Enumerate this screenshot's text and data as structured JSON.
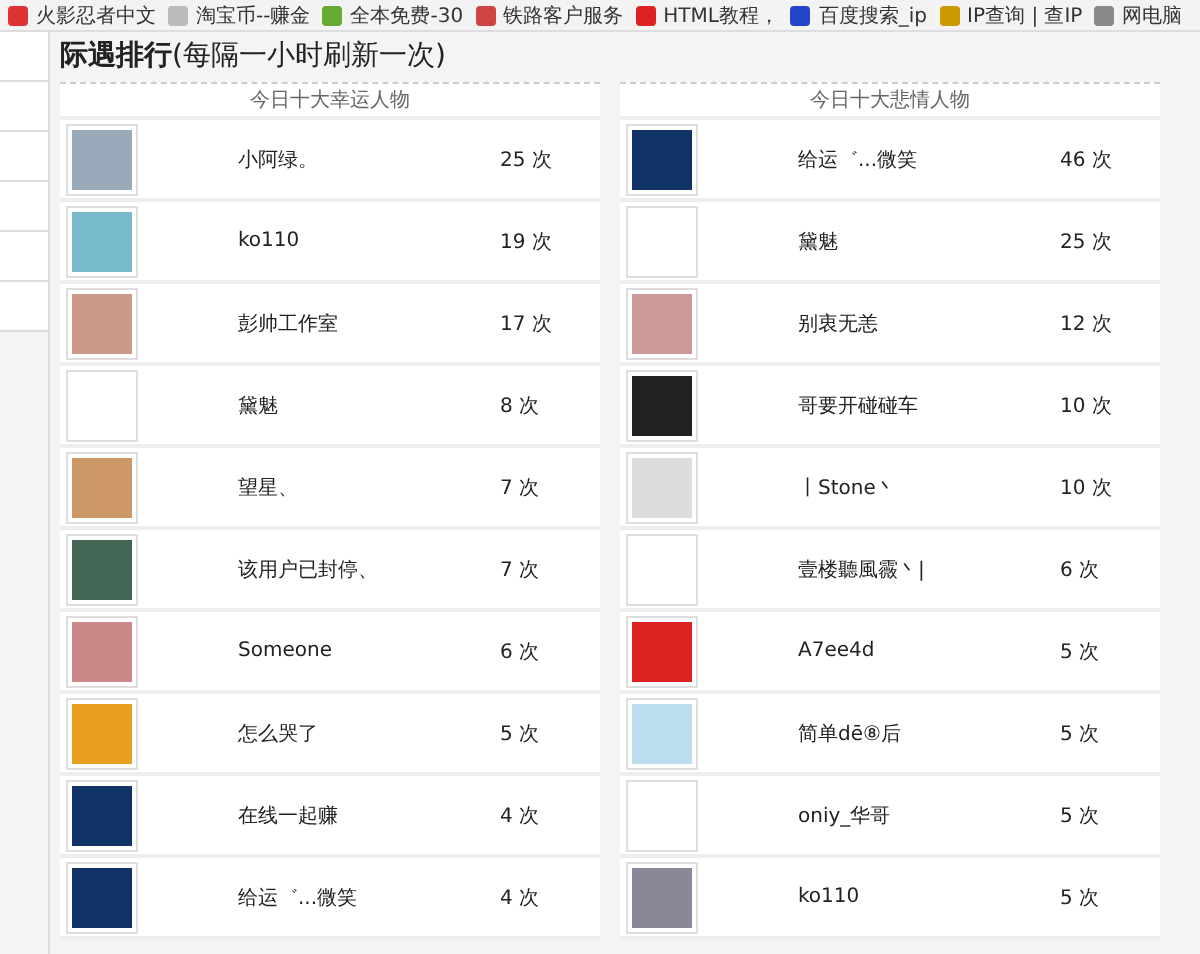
{
  "bookmarks": [
    {
      "label": "火影忍者中文"
    },
    {
      "label": "淘宝币--赚金"
    },
    {
      "label": "全本免费-30"
    },
    {
      "label": "铁路客户服务"
    },
    {
      "label": "HTML教程，"
    },
    {
      "label": "百度搜索_ip"
    },
    {
      "label": "IP查询 | 查IP"
    },
    {
      "label": "网电脑"
    }
  ],
  "panel": {
    "title": "**际遇排行**(每隔一小时刷新一次)",
    "lists": [
      {
        "heading": "今日十大幸运人物",
        "rows": [
          {
            "kind": "photo",
            "name": "小阿绿。",
            "count": "25 次"
          },
          {
            "kind": "photo",
            "name": "ko110",
            "count": "19 次"
          },
          {
            "kind": "photo",
            "name": "彭帅工作室",
            "count": "17 次"
          },
          {
            "kind": "empty",
            "name": "黛魅",
            "count": "8 次"
          },
          {
            "kind": "photo",
            "name": "望星、",
            "count": "7 次"
          },
          {
            "kind": "photo",
            "name": "该用户已封停、",
            "count": "7 次"
          },
          {
            "kind": "photo",
            "name": "Someone",
            "count": "6 次"
          },
          {
            "kind": "photo",
            "name": "怎么哭了",
            "count": "5 次"
          },
          {
            "kind": "photo",
            "name": "在线一起赚",
            "count": "4 次"
          },
          {
            "kind": "photo",
            "name": "给运゛...微笑",
            "count": "4 次"
          }
        ]
      },
      {
        "heading": "今日十大悲情人物",
        "rows": [
          {
            "kind": "photo",
            "name": "给运゛...微笑",
            "count": "46 次"
          },
          {
            "kind": "empty",
            "name": "黛魅",
            "count": "25 次"
          },
          {
            "kind": "photo",
            "name": "别衷无恙",
            "count": "12 次"
          },
          {
            "kind": "photo",
            "name": "哥要开碰碰车",
            "count": "10 次"
          },
          {
            "kind": "photo",
            "name": "丨Stone丶",
            "count": "10 次"
          },
          {
            "kind": "empty",
            "name": "壹楼聽風霺丶|",
            "count": "6 次"
          },
          {
            "kind": "photo",
            "name": "A7ee4d",
            "count": "5 次"
          },
          {
            "kind": "photo",
            "name": "简单dē⑧后",
            "count": "5 次"
          },
          {
            "kind": "empty",
            "name": "oniy_华哥",
            "count": "5 次"
          },
          {
            "kind": "photo",
            "name": "ko110",
            "count": "5 次"
          }
        ]
      }
    ]
  }
}
